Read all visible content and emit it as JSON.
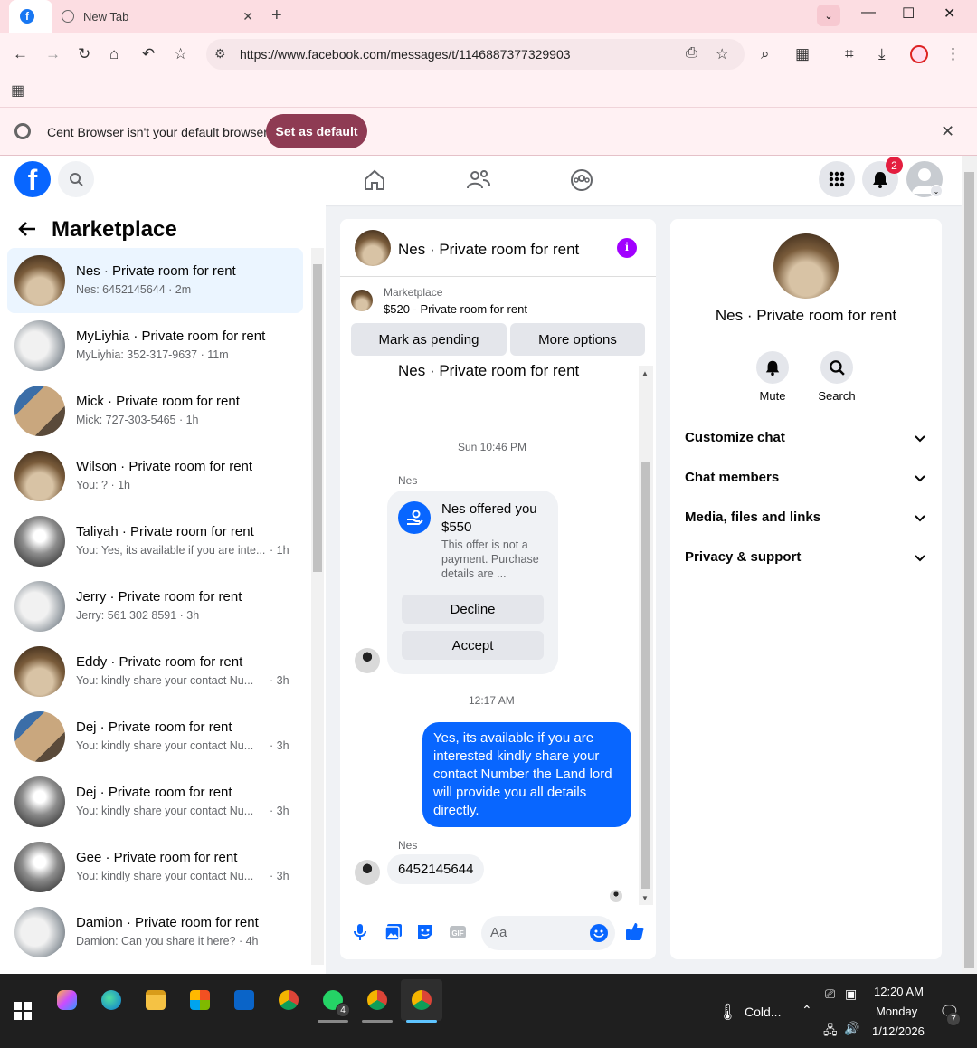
{
  "browser": {
    "tabs": [
      {
        "label": "",
        "icon": "facebook-favicon"
      },
      {
        "label": "New Tab",
        "icon": "globe-icon"
      }
    ],
    "url": "https://www.facebook.com/messages/t/1146887377329903",
    "infobar": {
      "text": "Cent Browser isn't your default browser",
      "button": "Set as default"
    }
  },
  "fb": {
    "notification_count": "2"
  },
  "sidebar": {
    "title": "Marketplace",
    "conversations": [
      {
        "name": "Nes · Private room for rent",
        "preview": "Nes: 6452145644 · 2m",
        "time": "",
        "active": true
      },
      {
        "name": "MyLiyhia · Private room for rent",
        "preview": "MyLiyhia: 352-317-9637 · 11m",
        "time": ""
      },
      {
        "name": "Mick · Private room for rent",
        "preview": "Mick: 727-303-5465 · 1h",
        "time": ""
      },
      {
        "name": "Wilson · Private room for rent",
        "preview": "You: ? · 1h",
        "time": ""
      },
      {
        "name": "Taliyah · Private room for rent",
        "preview": "You: Yes, its available if you are inte...",
        "time": "· 1h"
      },
      {
        "name": "Jerry · Private room for rent",
        "preview": "Jerry: 561 302 8591 · 3h",
        "time": ""
      },
      {
        "name": "Eddy · Private room for rent",
        "preview": "You: kindly share your contact Nu...",
        "time": "· 3h"
      },
      {
        "name": "Dej · Private room for rent",
        "preview": "You: kindly share your contact Nu...",
        "time": "· 3h"
      },
      {
        "name": "Dej · Private room for rent",
        "preview": "You: kindly share your contact Nu...",
        "time": "· 3h"
      },
      {
        "name": "Gee · Private room for rent",
        "preview": "You: kindly share your contact Nu...",
        "time": "· 3h"
      },
      {
        "name": "Damion · Private room for rent",
        "preview": "Damion: Can you share it here? · 4h",
        "time": ""
      }
    ]
  },
  "chat": {
    "header_title": "Nes · Private room for rent",
    "marketplace_label": "Marketplace",
    "listing": "$520 - Private room for rent",
    "mark_pending": "Mark as pending",
    "more_options": "More options",
    "thread_title": "Nes · Private room for rent",
    "time1": "Sun 10:46 PM",
    "sender1": "Nes",
    "offer_title": "Nes offered you $550",
    "offer_desc": "This offer is not a payment. Purchase details are ...",
    "decline": "Decline",
    "accept": "Accept",
    "time2": "12:17 AM",
    "outgoing": "Yes, its available if you are interested kindly share your contact Number the Land lord will provide you all details directly.",
    "sender2": "Nes",
    "incoming": "6452145644",
    "composer_placeholder": "Aa"
  },
  "info_panel": {
    "title": "Nes · Private room for rent",
    "mute": "Mute",
    "search": "Search",
    "rows": [
      "Customize chat",
      "Chat members",
      "Media, files and links",
      "Privacy & support"
    ]
  },
  "taskbar": {
    "weather": "Cold...",
    "time": "12:20 AM",
    "day": "Monday",
    "date": "1/12/2026",
    "whatsapp_badge": "4",
    "notif_count": "7"
  },
  "colors": {
    "fb_blue": "#0866ff",
    "set_default_btn": "#8e3b53",
    "tab_bar": "#fcdde2"
  }
}
